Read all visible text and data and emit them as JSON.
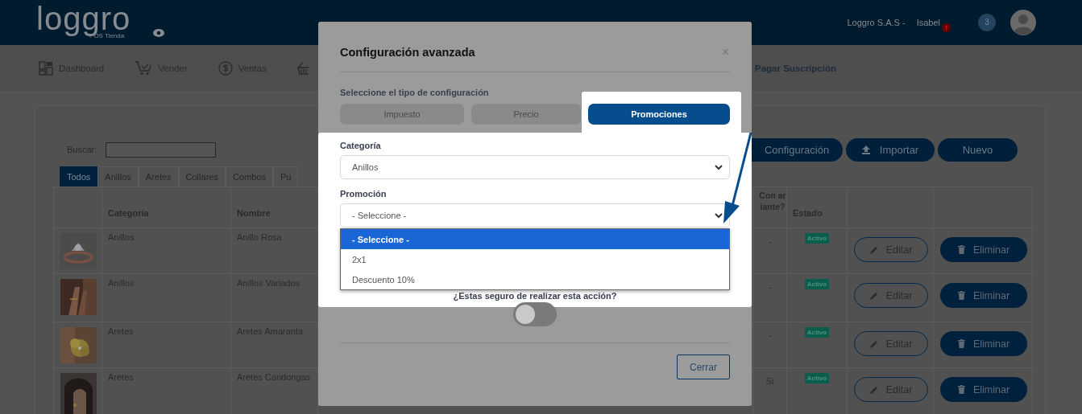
{
  "header": {
    "logo": "loggro",
    "logo_subtitle": "POS Tienda",
    "company": "Loggro S.A.S -",
    "user": "Isabel",
    "alert_badge": "!",
    "notification_count": "3"
  },
  "nav": [
    {
      "kind": "menu",
      "label": "Dashboard"
    },
    {
      "kind": "menu",
      "label": "Vender"
    },
    {
      "kind": "menu",
      "label": "Ventas"
    },
    {
      "kind": "menu"
    },
    {
      "kind": "subscription",
      "label": "Pagar Suscripción"
    }
  ],
  "search": {
    "label": "Buscar:"
  },
  "actions": [
    {
      "label": "Configuración",
      "kind": "cut"
    },
    {
      "label": "Importar",
      "kind": "upload"
    },
    {
      "label": "Nuevo",
      "kind": "plain"
    }
  ],
  "category_tabs": [
    {
      "label": "Todos",
      "selected": true
    },
    {
      "label": "Anillos",
      "selected": false
    },
    {
      "label": "Aretes",
      "selected": false
    },
    {
      "label": "Collares",
      "selected": false
    },
    {
      "label": "Combos",
      "selected": false
    },
    {
      "label": "Pu",
      "selected": false
    }
  ],
  "table": {
    "columns": [
      "Categoría",
      "Nombre"
    ],
    "right_columns": [
      "Con ariante?",
      "Estado"
    ],
    "rows": [
      {
        "category": "Anillos",
        "name": "Anillo Rosa",
        "variant": "-",
        "status": "Activo",
        "edit": "Editar",
        "delete": "Eliminar"
      },
      {
        "category": "Anillos",
        "name": "Anillos Variados",
        "variant": "-",
        "status": "Activo",
        "edit": "Editar",
        "delete": "Eliminar"
      },
      {
        "category": "Aretes",
        "name": "Aretes Amaranta",
        "variant": "-",
        "status": "Activo",
        "edit": "Editar",
        "delete": "Eliminar"
      },
      {
        "category": "Aretes",
        "name": "Aretes Candongas",
        "variant": "Si",
        "status": "Activo",
        "edit": "Editar",
        "delete": "Eliminar"
      }
    ]
  },
  "modal": {
    "title": "Configuración avanzada",
    "close": "×",
    "type_label": "Seleccione el tipo de configuración",
    "types": [
      {
        "label": "Impuesto",
        "selected": false
      },
      {
        "label": "Precio",
        "selected": false
      },
      {
        "label": "Promociones",
        "selected": true
      }
    ],
    "fields": [
      {
        "label": "Categoría",
        "value": "Anillos"
      },
      {
        "label": "Promoción",
        "value": "- Seleccione -",
        "options": [
          {
            "label": "- Seleccione -",
            "selected": true
          },
          {
            "label": "2x1",
            "selected": false
          },
          {
            "label": "Descuento 10%",
            "selected": false
          }
        ]
      }
    ],
    "question": "¿Estas seguro de realizar esta acción?",
    "toggle": {
      "on": false
    },
    "close_button": "Cerrar"
  }
}
